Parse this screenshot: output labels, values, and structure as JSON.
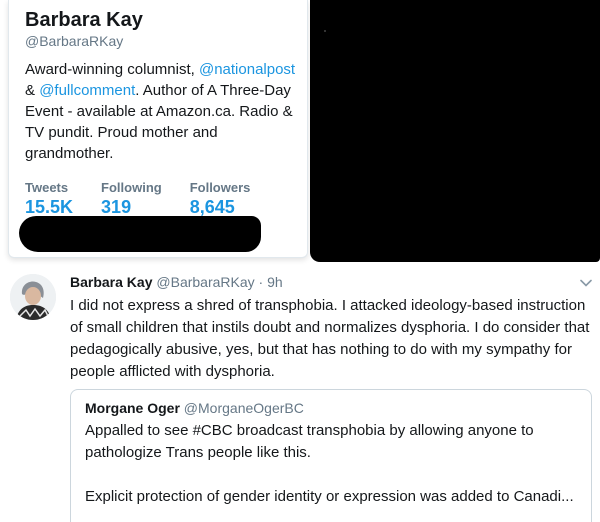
{
  "profile_card": {
    "name": "Barbara Kay",
    "handle": "@BarbaraRKay",
    "bio_prefix": "Award-winning columnist, ",
    "bio_link1": "@nationalpost",
    "bio_middle": " & ",
    "bio_link2": "@fullcomment",
    "bio_suffix": ". Author of A Three-Day Event - available at Amazon.ca. Radio & TV pundit. Proud mother and grandmother.",
    "stats": [
      {
        "label": "Tweets",
        "value": "15.5K"
      },
      {
        "label": "Following",
        "value": "319"
      },
      {
        "label": "Followers",
        "value": "8,645"
      }
    ]
  },
  "tweet": {
    "name": "Barbara Kay",
    "handle": "@BarbaraRKay",
    "separator": " · ",
    "time": "9h",
    "text": "I did not express a shred of transphobia. I attacked ideology-based instruction of small children that instils doubt and normalizes dysphoria. I do consider that pedagogically abusive, yes, but that has nothing to do with my sympathy for people afflicted with dysphoria.",
    "chevron_icon": "chevron-down-icon"
  },
  "quoted_tweet": {
    "name": "Morgane Oger",
    "handle": "@MorganeOgerBC",
    "text_para1": "Appalled to see #CBC broadcast transphobia by allowing anyone to pathologize Trans people like this.",
    "text_para2": "Explicit protection of gender identity or expression was added to Canadi..."
  },
  "colors": {
    "link": "#1b95e0",
    "secondary_text": "#657786",
    "redaction": "#000000"
  }
}
